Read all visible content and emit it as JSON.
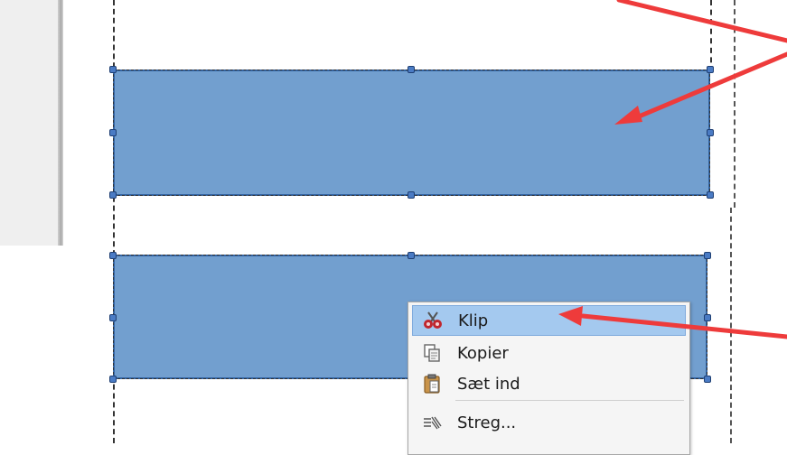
{
  "context_menu": {
    "items": [
      {
        "label": "Klip",
        "icon": "scissors-icon",
        "highlighted": true
      },
      {
        "label": "Kopier",
        "icon": "copy-icon",
        "highlighted": false
      },
      {
        "label": "Sæt ind",
        "icon": "paste-icon",
        "highlighted": false
      },
      {
        "label": "Streg...",
        "icon": "line-style-icon",
        "highlighted": false
      }
    ]
  },
  "colors": {
    "shape_fill": "#729fcf",
    "shape_border": "#3465a4",
    "menu_highlight": "#a4c9ef",
    "annotation_arrow": "#ee3b3b"
  }
}
